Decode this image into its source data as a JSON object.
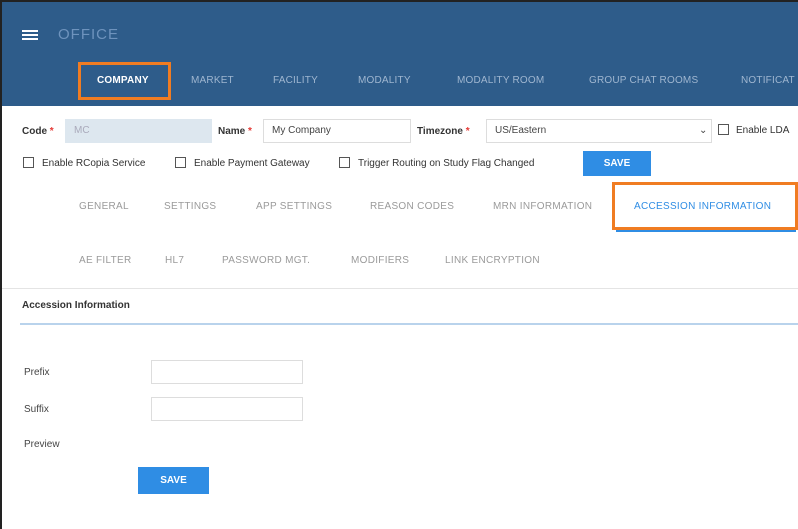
{
  "app": {
    "title": "OFFICE"
  },
  "nav": {
    "tabs": [
      {
        "label": "COMPANY"
      },
      {
        "label": "MARKET"
      },
      {
        "label": "FACILITY"
      },
      {
        "label": "MODALITY"
      },
      {
        "label": "MODALITY ROOM"
      },
      {
        "label": "GROUP CHAT ROOMS"
      },
      {
        "label": "NOTIFICAT"
      }
    ]
  },
  "company_form": {
    "code_label": "Code",
    "code_value": "MC",
    "name_label": "Name",
    "name_value": "My Company",
    "timezone_label": "Timezone",
    "timezone_value": "US/Eastern",
    "enable_ldap_label": "Enable LDA",
    "rcopia_label": "Enable RCopia Service",
    "payment_label": "Enable Payment Gateway",
    "trigger_label": "Trigger Routing on Study Flag Changed",
    "save_label": "SAVE"
  },
  "subtabs": {
    "row1": [
      {
        "label": "GENERAL"
      },
      {
        "label": "SETTINGS"
      },
      {
        "label": "APP SETTINGS"
      },
      {
        "label": "REASON CODES"
      },
      {
        "label": "MRN INFORMATION"
      },
      {
        "label": "ACCESSION INFORMATION"
      }
    ],
    "row2": [
      {
        "label": "AE FILTER"
      },
      {
        "label": "HL7"
      },
      {
        "label": "PASSWORD MGT."
      },
      {
        "label": "MODIFIERS"
      },
      {
        "label": "LINK ENCRYPTION"
      }
    ]
  },
  "accession": {
    "section_title": "Accession Information",
    "prefix_label": "Prefix",
    "prefix_value": "",
    "suffix_label": "Suffix",
    "suffix_value": "",
    "preview_label": "Preview",
    "save_label": "SAVE"
  },
  "colors": {
    "header_bg": "#2e5c8a",
    "accent": "#2f8de4",
    "highlight": "#f07c22"
  }
}
